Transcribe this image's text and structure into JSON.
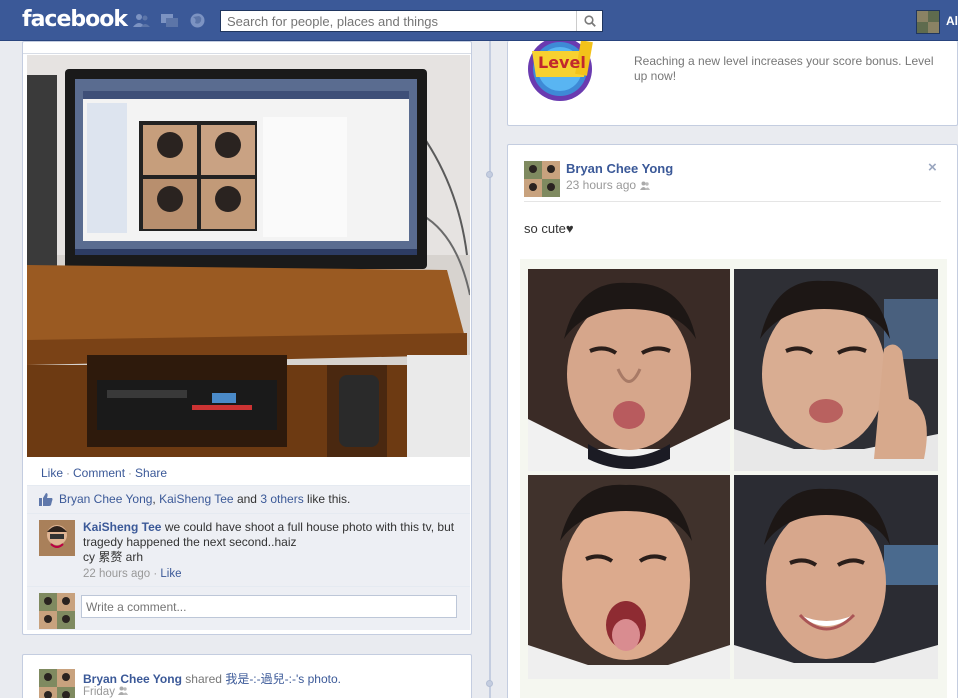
{
  "topbar": {
    "logo": "facebook",
    "search_placeholder": "Search for people, places and things",
    "user_name": "Al"
  },
  "post_left": {
    "actions": {
      "like": "Like",
      "comment": "Comment",
      "share": "Share"
    },
    "likes": {
      "name1": "Bryan Chee Yong",
      "name2": "KaiSheng Tee",
      "and": "and",
      "others": "3 others",
      "suffix": "like this."
    },
    "comment": {
      "author": "KaiSheng Tee",
      "text": "we could have shoot a full house photo with this tv, but tragedy happened the next second..haiz",
      "text2": "cy 累赘 arh",
      "time": "22 hours ago",
      "like": "Like"
    },
    "write_placeholder": "Write a comment..."
  },
  "post_left_2": {
    "author": "Bryan Chee Yong",
    "shared": "shared",
    "owner": "我是-:-過兒-:-",
    "photo_link": "'s photo.",
    "time": "Friday"
  },
  "game_card": {
    "badge": "Level",
    "text": "Reaching a new level increases your score bonus. Level up now!"
  },
  "post_right": {
    "author": "Bryan Chee Yong",
    "time": "23 hours ago",
    "close": "×",
    "status": "so cute♥"
  },
  "colors": {
    "brand": "#3b5998",
    "background": "#e9ebf0",
    "ufi": "#edeff4"
  }
}
